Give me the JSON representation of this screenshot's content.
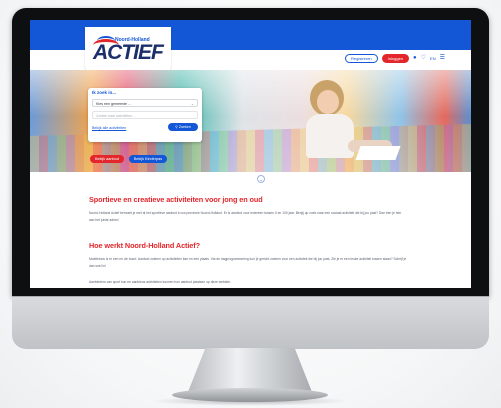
{
  "site": {
    "logo_small": "Noord-Holland",
    "logo_main": "ACTIEF"
  },
  "header": {
    "register_label": "Registreren",
    "login_label": "Inloggen",
    "lang_label": "EN",
    "icons": [
      "user-icon",
      "heart-icon",
      "menu-icon"
    ]
  },
  "search": {
    "title": "Ik zoek in...",
    "select_value": "Kies een gemeente ...",
    "input_placeholder": "Zoeken naar activiteiten...",
    "all_link": "Bekijk alle activiteiten",
    "search_button": "Zoeken"
  },
  "hero_buttons": {
    "aanbod": "Bekijk aanbod",
    "kinderpas": "Bekijk Kinderpas"
  },
  "sections": [
    {
      "title": "Sportieve en creatieve activiteiten voor jong en oud",
      "text": "Noord-Holland Actief bemoeit je met al het sportieve aanbod in uw provincie Noord-Holland. Er is aanbod voor iedereen tussen 0 en 100 jaar. Benjij op zoek naar een sociaal activiteit die bij jou past? Dan ben je hier aan het juiste adres!"
    },
    {
      "title": "Hoe werkt Noord-Holland Actief?",
      "text": "Moeiteloos is er een rm de buurt. Aanbod zoeken op activiteiten kan en een plaats. Via de dagprogrammering kun je gericht zoeken voor een activiteit die bij jou past. Zie je er een leuke activiteit tussen staan? Schrijf je dan snel in!",
      "text2": "Aanbieders van sport kun en aanbieus activiteiten kunnen hun aanbod plaatsen op deze website."
    }
  ],
  "colors": {
    "brand_blue": "#1457d6",
    "accent_red": "#e3262b"
  }
}
